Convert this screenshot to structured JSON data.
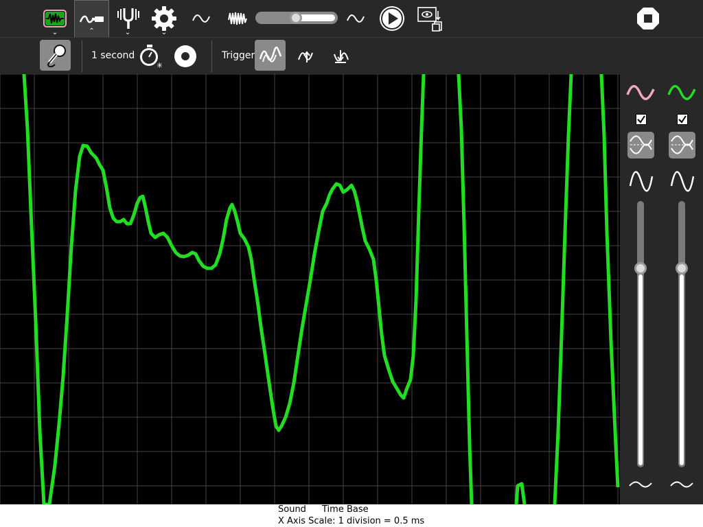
{
  "toolbar": {
    "icons": [
      "oscilloscope-icon",
      "sensor-toolbar-icon",
      "tuning-fork-icon",
      "gear-icon",
      "sine-wave-icon",
      "complex-wave-icon",
      "sine-wave-icon",
      "play-icon",
      "copy-to-journal-icon",
      "stop-icon"
    ],
    "frequency_slider_level": 0.5
  },
  "subbar": {
    "duration_label": "1 second",
    "trigger_label": "Trigger"
  },
  "side": {
    "channel1_color": "#f4a7c0",
    "channel2_color": "#22dd22",
    "channel1_checked": true,
    "channel2_checked": true,
    "channel1_gain_level": 0.27,
    "channel2_gain_level": 0.27
  },
  "status": {
    "source": "Sound",
    "mode": "Time Base",
    "scale": "X Axis Scale: 1 division = 0.5 ms"
  },
  "colors": {
    "trace": "#22dd22",
    "grid": "#444444",
    "bar": "#282828"
  }
}
